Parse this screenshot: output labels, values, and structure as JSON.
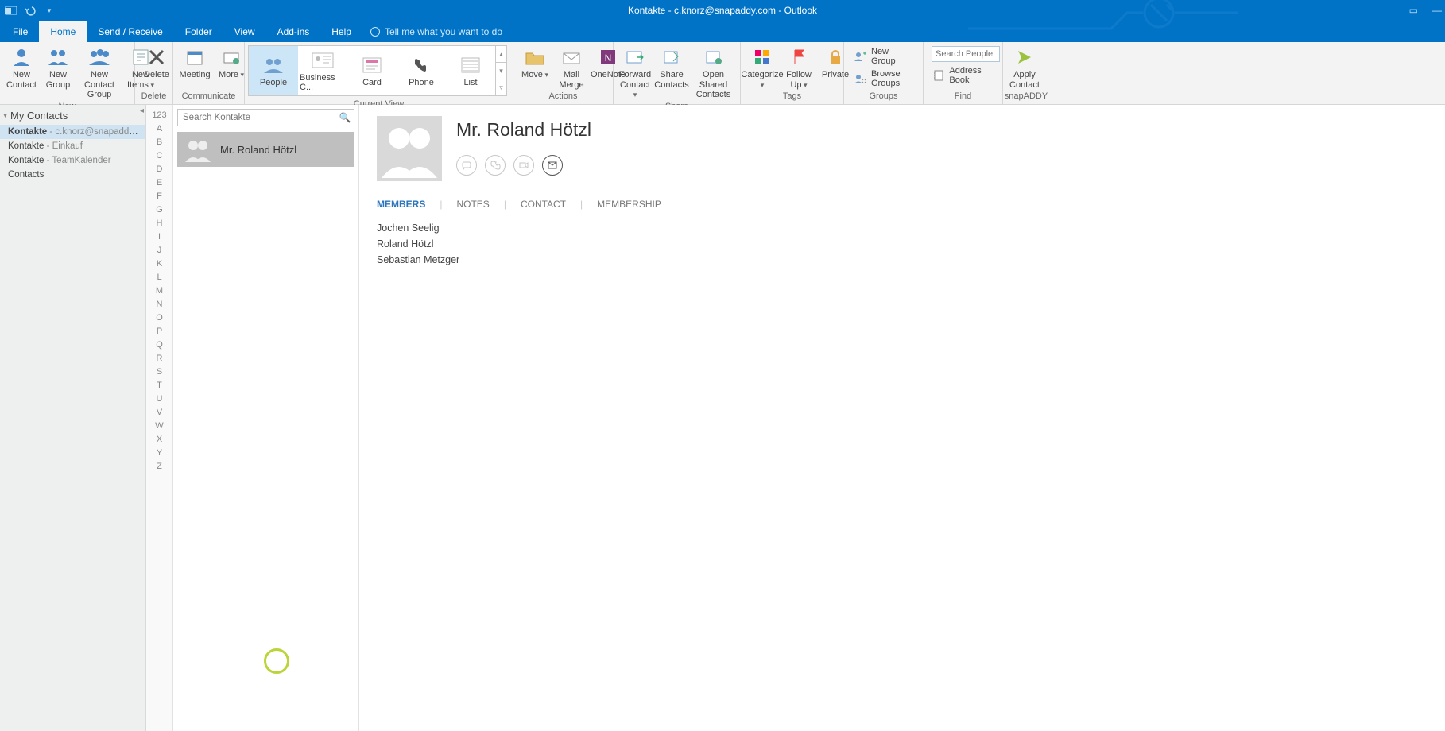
{
  "titlebar": {
    "title": "Kontakte - c.knorz@snapaddy.com  -  Outlook"
  },
  "tabs": {
    "file": "File",
    "home": "Home",
    "send_receive": "Send / Receive",
    "folder": "Folder",
    "view": "View",
    "addins": "Add-ins",
    "help": "Help",
    "tellme": "Tell me what you want to do"
  },
  "ribbon": {
    "new": {
      "label": "New",
      "new_contact": "New\nContact",
      "new_group": "New\nGroup",
      "new_contact_group": "New Contact\nGroup",
      "new_items": "New\nItems"
    },
    "delete": {
      "label": "Delete",
      "delete": "Delete"
    },
    "communicate": {
      "label": "Communicate",
      "meeting": "Meeting",
      "more": "More"
    },
    "current_view": {
      "label": "Current View",
      "people": "People",
      "business": "Business C...",
      "card": "Card",
      "phone": "Phone",
      "list": "List"
    },
    "actions": {
      "label": "Actions",
      "move": "Move",
      "mail_merge": "Mail\nMerge",
      "onenote": "OneNote"
    },
    "share": {
      "label": "Share",
      "forward": "Forward\nContact",
      "share_contacts": "Share\nContacts",
      "open_shared": "Open Shared\nContacts"
    },
    "tags": {
      "label": "Tags",
      "categorize": "Categorize",
      "follow_up": "Follow\nUp",
      "private": "Private"
    },
    "groups": {
      "label": "Groups",
      "new_group": "New Group",
      "browse_groups": "Browse Groups"
    },
    "find": {
      "label": "Find",
      "search_placeholder": "Search People",
      "address_book": "Address Book"
    },
    "snapaddy": {
      "label": "snapADDY",
      "apply_contact": "Apply\nContact"
    }
  },
  "nav": {
    "header": "My Contacts",
    "items": [
      {
        "primary": "Kontakte",
        "secondary": " - c.knorz@snapaddy.com",
        "active": true
      },
      {
        "primary": "Kontakte",
        "secondary": " - Einkauf",
        "active": false
      },
      {
        "primary": "Kontakte",
        "secondary": " - TeamKalender",
        "active": false
      },
      {
        "primary": "Contacts",
        "secondary": "",
        "active": false
      }
    ]
  },
  "az": [
    "123",
    "A",
    "B",
    "C",
    "D",
    "E",
    "F",
    "G",
    "H",
    "I",
    "J",
    "K",
    "L",
    "M",
    "N",
    "O",
    "P",
    "Q",
    "R",
    "S",
    "T",
    "U",
    "V",
    "W",
    "X",
    "Y",
    "Z"
  ],
  "list": {
    "search_placeholder": "Search Kontakte",
    "card_name": "Mr. Roland Hötzl"
  },
  "reading": {
    "title": "Mr. Roland Hötzl",
    "tabs": {
      "members": "MEMBERS",
      "notes": "NOTES",
      "contact": "CONTACT",
      "membership": "MEMBERSHIP"
    },
    "members": [
      "Jochen Seelig",
      "Roland Hötzl",
      "Sebastian Metzger"
    ]
  }
}
